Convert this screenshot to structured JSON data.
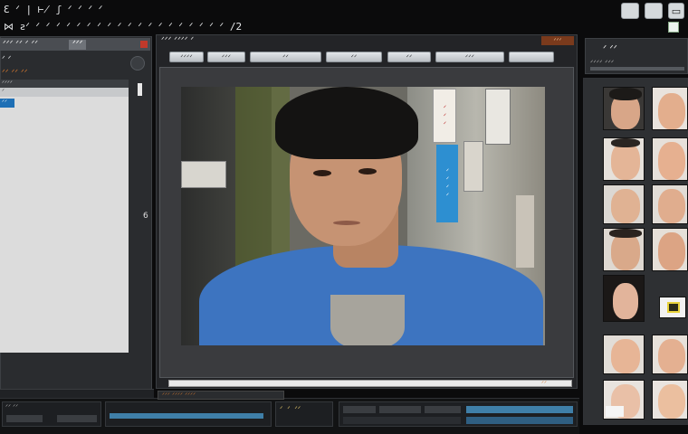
{
  "titlebar": {
    "line1": "Ɛ ᐟ | ⊬ ʃ ᐟ ᐟ ᐟ ᐟ",
    "line2": "⋈ ƨᐟ ᐟ ᐟ ᐟ ᐟ ᐟ ᐟ ᐟ ᐟ ᐟ ᐟ ᐟ ᐟ ᐟ ᐟ ᐟ ᐟ ᐟ ᐟ ᐟ /2"
  },
  "left_panel": {
    "header": "ᐟᐟᐟ ᐟᐟ ᐟ ᐟᐟ",
    "tab": "ᐟᐟᐟ",
    "label1": "ᐟ ᐟ",
    "label2": "ᐟᐟ ᐟᐟ ᐟᐟ",
    "list_header": "ᐟᐟᐟᐟ",
    "list_items": [
      "ᐟ",
      "ᐟᐟ"
    ],
    "side_number": "6"
  },
  "viewer": {
    "title": "ᐟᐟᐟ ᐟᐟᐟᐟ ᐟ",
    "badge": "ᐟᐟᐟ",
    "toolbar": [
      "ᐟᐟᐟᐟ",
      "ᐟᐟᐟ",
      "ᐟᐟ",
      "ᐟᐟ",
      "ᐟᐟ",
      "ᐟᐟᐟ",
      ""
    ],
    "footer_badge": "ᐟᐟ",
    "sign_red": "ᐟᐟᐟ",
    "sign_blue": "ᐟᐟᐟᐟ"
  },
  "right_panel": {
    "title": "ᐟ ᐟᐟ",
    "subtitle": "ᐟᐟᐟᐟ ᐟᐟᐟ"
  },
  "bottom": {
    "left_label": "ᐟᐟ ᐟᐟ",
    "mid_label": "ᐟᐟᐟ ᐟᐟᐟᐟ ᐟᐟᐟᐟ",
    "counter": "ᐟ ᐟ ᐟᐟ"
  },
  "colors": {
    "accent_orange": "#d2762e",
    "timeline_blue": "#3f7fa8",
    "shirt_blue": "#3d74c0"
  }
}
